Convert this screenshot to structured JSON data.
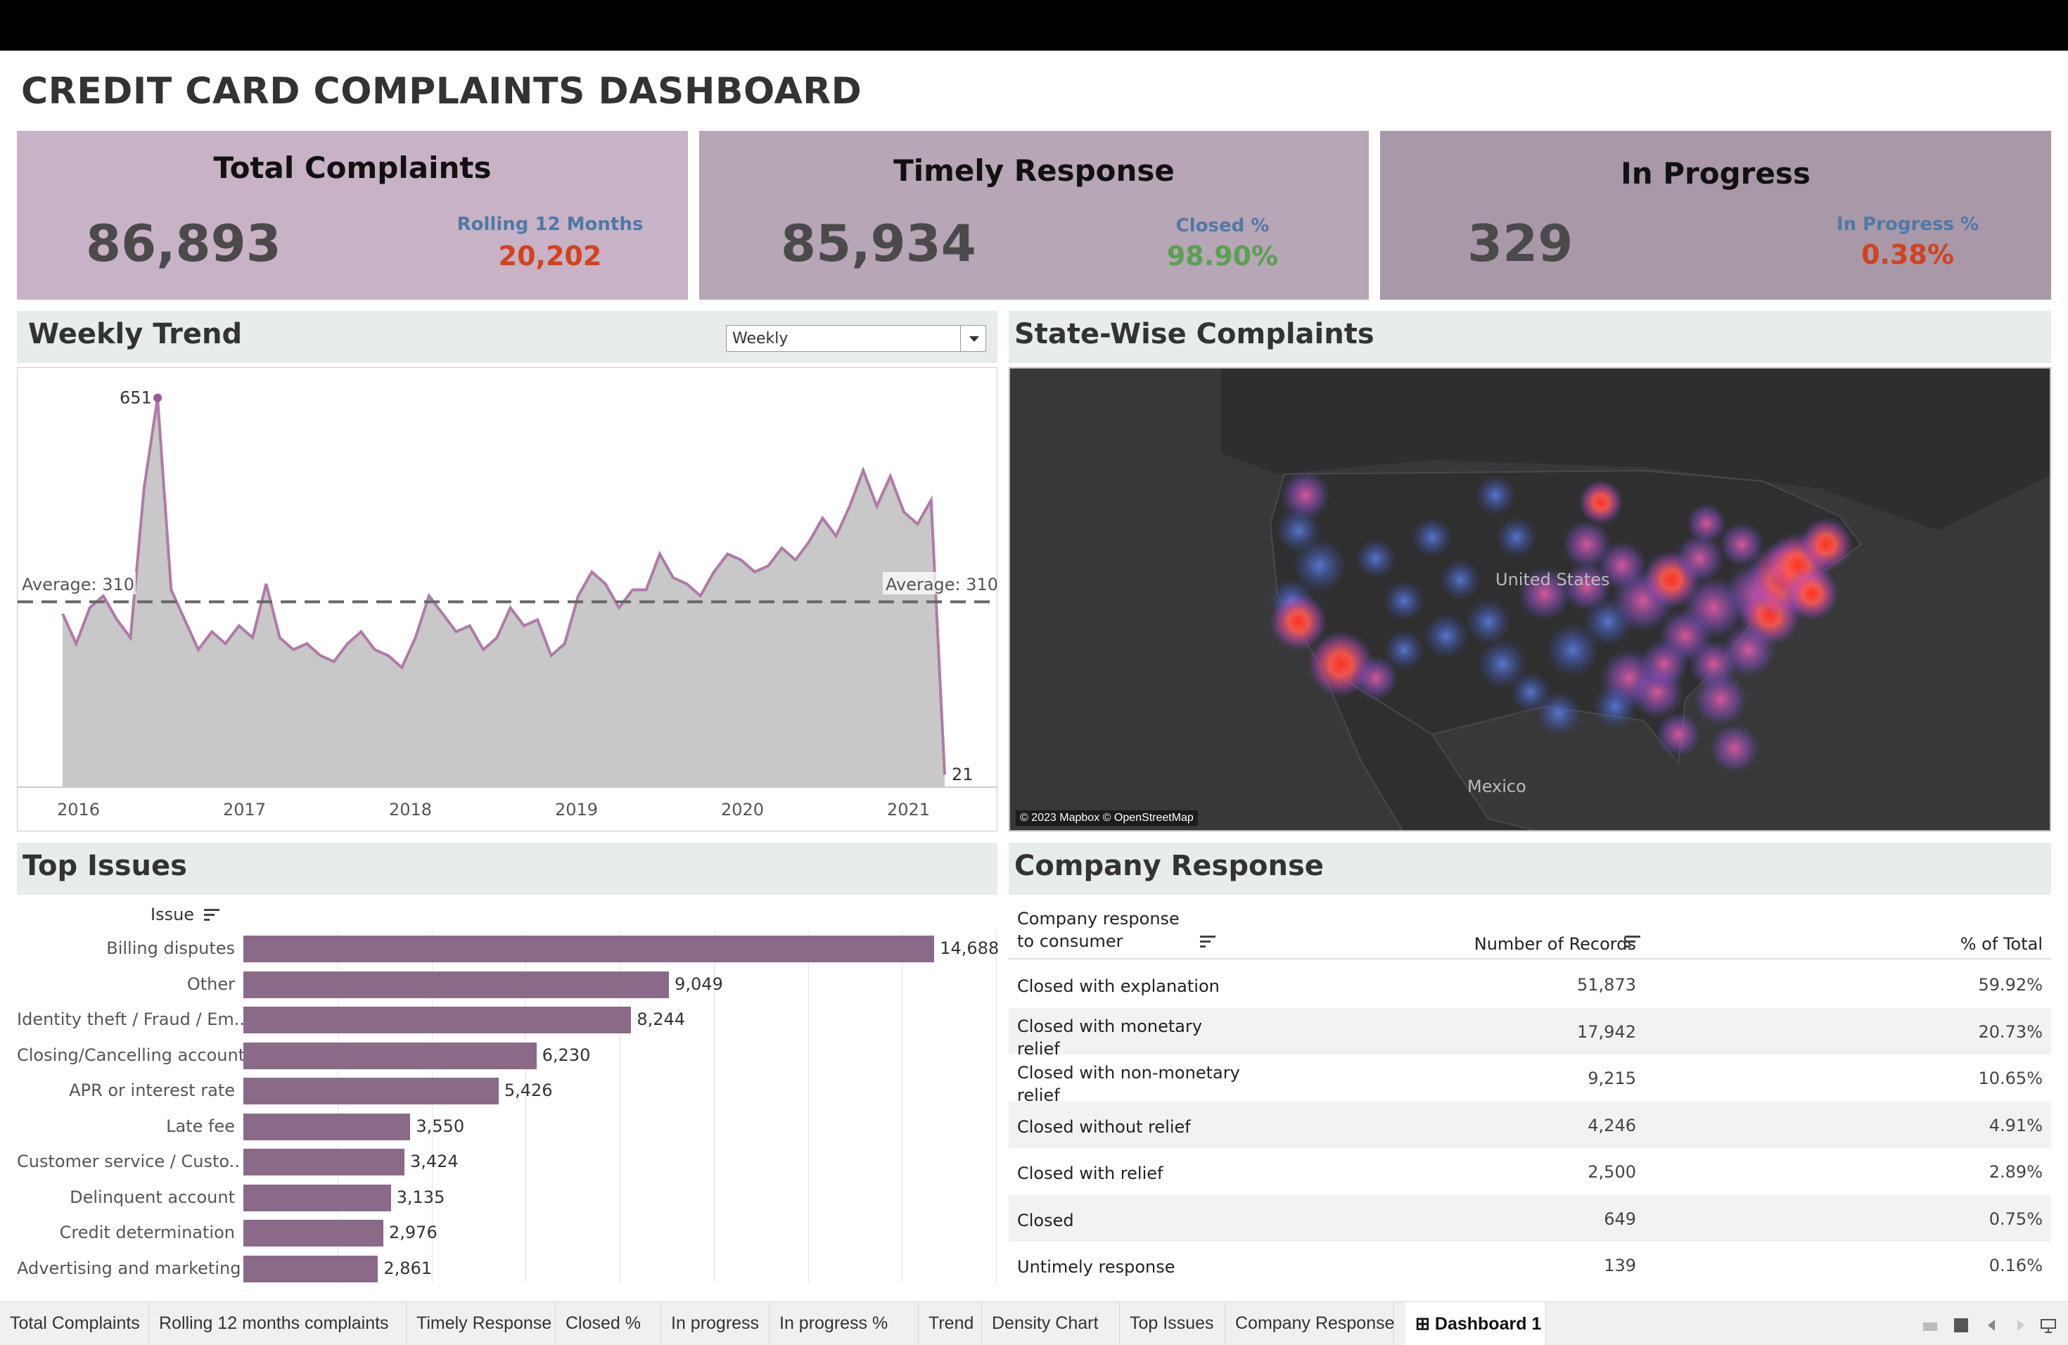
{
  "title": "CREDIT CARD COMPLAINTS DASHBOARD",
  "kpis": [
    {
      "title": "Total Complaints",
      "value": "86,893",
      "sub_label": "Rolling 12 Months",
      "sub_value": "20,202",
      "bg": "#c8b2c5",
      "sub_color": "#d2421c"
    },
    {
      "title": "Timely Response",
      "value": "85,934",
      "sub_label": "Closed %",
      "sub_value": "98.90%",
      "bg": "#b6a6b6",
      "sub_color": "#59a14f"
    },
    {
      "title": "In Progress",
      "value": "329",
      "sub_label": "In Progress %",
      "sub_value": "0.38%",
      "bg": "#a898a8",
      "sub_color": "#d2421c"
    }
  ],
  "weekly_trend": {
    "title": "Weekly Trend",
    "selector_value": "Weekly",
    "average_label": "Average: 310",
    "max_label": "651",
    "last_label": "21"
  },
  "state_map": {
    "title": "State-Wise Complaints",
    "labels": [
      "United States",
      "Mexico"
    ],
    "credit": "© 2023 Mapbox © OpenStreetMap"
  },
  "top_issues": {
    "title": "Top Issues",
    "column_header": "Issue",
    "bar_color": "#8a6a88"
  },
  "company_response": {
    "title": "Company Response",
    "headers": [
      "Company response to consumer",
      "Number of Records",
      "% of Total"
    ],
    "rows": [
      {
        "response": "Closed with explanation",
        "records": "51,873",
        "pct": "59.92%"
      },
      {
        "response": "Closed with monetary relief",
        "records": "17,942",
        "pct": "20.73%"
      },
      {
        "response": "Closed with non-monetary relief",
        "records": "9,215",
        "pct": "10.65%"
      },
      {
        "response": "Closed without relief",
        "records": "4,246",
        "pct": "4.91%"
      },
      {
        "response": "Closed with relief",
        "records": "2,500",
        "pct": "2.89%"
      },
      {
        "response": "Closed",
        "records": "649",
        "pct": "0.75%"
      },
      {
        "response": "Untimely response",
        "records": "139",
        "pct": "0.16%"
      }
    ]
  },
  "tabs": [
    "Total Complaints",
    "Rolling 12 months complaints",
    "Timely Response",
    "Closed %",
    "In progress",
    "In progress %",
    "Trend",
    "Density Chart",
    "Top Issues",
    "Company Response",
    "Dashboard 1"
  ],
  "active_tab": "Dashboard 1",
  "chart_data": [
    {
      "type": "area",
      "title": "Weekly Trend",
      "x_ticks": [
        "2016",
        "2017",
        "2018",
        "2019",
        "2020",
        "2021"
      ],
      "x": [
        "2015-12",
        "2016-01",
        "2016-02",
        "2016-03",
        "2016-04",
        "2016-05",
        "2016-06",
        "2016-07",
        "2016-08",
        "2016-09",
        "2016-10",
        "2016-11",
        "2016-12",
        "2017-01",
        "2017-02",
        "2017-03",
        "2017-04",
        "2017-05",
        "2017-06",
        "2017-07",
        "2017-08",
        "2017-09",
        "2017-10",
        "2017-11",
        "2017-12",
        "2018-01",
        "2018-02",
        "2018-03",
        "2018-04",
        "2018-05",
        "2018-06",
        "2018-07",
        "2018-08",
        "2018-09",
        "2018-10",
        "2018-11",
        "2018-12",
        "2019-01",
        "2019-02",
        "2019-03",
        "2019-04",
        "2019-05",
        "2019-06",
        "2019-07",
        "2019-08",
        "2019-09",
        "2019-10",
        "2019-11",
        "2019-12",
        "2020-01",
        "2020-02",
        "2020-03",
        "2020-04",
        "2020-05",
        "2020-06",
        "2020-07",
        "2020-08",
        "2020-09",
        "2020-10",
        "2020-11",
        "2020-12",
        "2021-01",
        "2021-02",
        "2021-03",
        "2021-04",
        "2021-05"
      ],
      "values": [
        290,
        240,
        300,
        320,
        280,
        250,
        500,
        651,
        330,
        280,
        230,
        260,
        240,
        270,
        250,
        340,
        250,
        230,
        240,
        220,
        210,
        240,
        260,
        230,
        220,
        200,
        250,
        320,
        290,
        260,
        270,
        230,
        250,
        300,
        270,
        280,
        220,
        240,
        320,
        360,
        340,
        300,
        330,
        330,
        390,
        350,
        340,
        320,
        360,
        390,
        380,
        360,
        370,
        400,
        380,
        410,
        450,
        420,
        470,
        530,
        470,
        520,
        460,
        440,
        480,
        21
      ],
      "average": 310,
      "ylim": [
        0,
        680
      ],
      "line_color": "#b07aa8",
      "fill_color": "#c8c8c8"
    },
    {
      "type": "bar",
      "title": "Top Issues",
      "categories": [
        "Billing disputes",
        "Other",
        "Identity theft / Fraud / Em..",
        "Closing/Cancelling account",
        "APR or interest rate",
        "Late fee",
        "Customer service / Custo..",
        "Delinquent account",
        "Credit determination",
        "Advertising and marketing"
      ],
      "values": [
        14688,
        9049,
        8244,
        6230,
        5426,
        3550,
        3424,
        3135,
        2976,
        2861
      ],
      "value_labels": [
        "14,688",
        "9,049",
        "8,244",
        "6,230",
        "5,426",
        "3,550",
        "3,424",
        "3,135",
        "2,976",
        "2,861"
      ],
      "xlim": [
        0,
        16000
      ]
    }
  ]
}
